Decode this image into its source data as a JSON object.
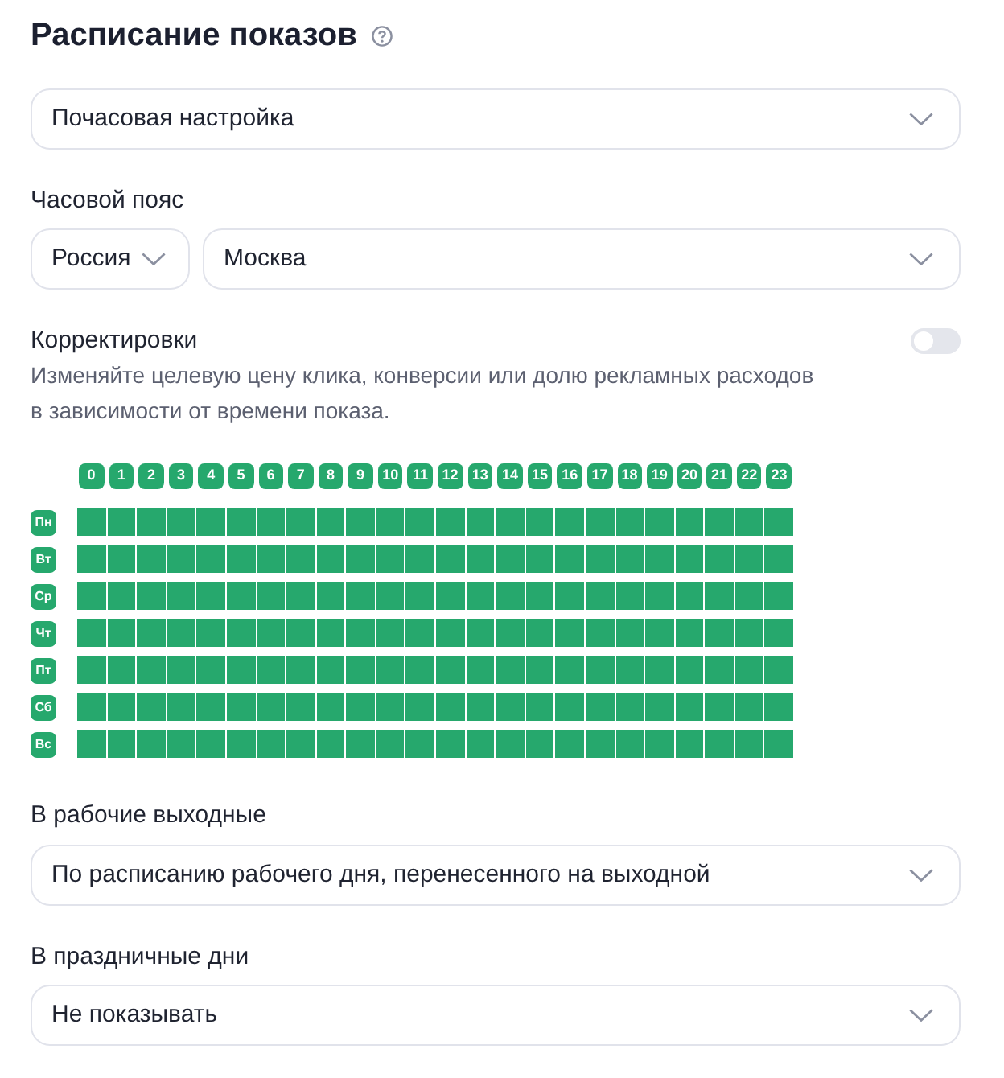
{
  "title": "Расписание показов",
  "mode": {
    "value": "Почасовая настройка"
  },
  "timezone": {
    "label": "Часовой пояс",
    "country": {
      "value": "Россия"
    },
    "city": {
      "value": "Москва"
    }
  },
  "adjustments": {
    "label": "Корректировки",
    "on": false,
    "description": "Изменяйте целевую цену клика, конверсии или долю рекламных расходов в зависимости от времени показа."
  },
  "schedule": {
    "hours": [
      "0",
      "1",
      "2",
      "3",
      "4",
      "5",
      "6",
      "7",
      "8",
      "9",
      "10",
      "11",
      "12",
      "13",
      "14",
      "15",
      "16",
      "17",
      "18",
      "19",
      "20",
      "21",
      "22",
      "23"
    ],
    "days": [
      {
        "label": "Пн",
        "cells": [
          true,
          true,
          true,
          true,
          true,
          true,
          true,
          true,
          true,
          true,
          true,
          true,
          true,
          true,
          true,
          true,
          true,
          true,
          true,
          true,
          true,
          true,
          true,
          true
        ]
      },
      {
        "label": "Вт",
        "cells": [
          true,
          true,
          true,
          true,
          true,
          true,
          true,
          true,
          true,
          true,
          true,
          true,
          true,
          true,
          true,
          true,
          true,
          true,
          true,
          true,
          true,
          true,
          true,
          true
        ]
      },
      {
        "label": "Ср",
        "cells": [
          true,
          true,
          true,
          true,
          true,
          true,
          true,
          true,
          true,
          true,
          true,
          true,
          true,
          true,
          true,
          true,
          true,
          true,
          true,
          true,
          true,
          true,
          true,
          true
        ]
      },
      {
        "label": "Чт",
        "cells": [
          true,
          true,
          true,
          true,
          true,
          true,
          true,
          true,
          true,
          true,
          true,
          true,
          true,
          true,
          true,
          true,
          true,
          true,
          true,
          true,
          true,
          true,
          true,
          true
        ]
      },
      {
        "label": "Пт",
        "cells": [
          true,
          true,
          true,
          true,
          true,
          true,
          true,
          true,
          true,
          true,
          true,
          true,
          true,
          true,
          true,
          true,
          true,
          true,
          true,
          true,
          true,
          true,
          true,
          true
        ]
      },
      {
        "label": "Сб",
        "cells": [
          true,
          true,
          true,
          true,
          true,
          true,
          true,
          true,
          true,
          true,
          true,
          true,
          true,
          true,
          true,
          true,
          true,
          true,
          true,
          true,
          true,
          true,
          true,
          true
        ]
      },
      {
        "label": "Вс",
        "cells": [
          true,
          true,
          true,
          true,
          true,
          true,
          true,
          true,
          true,
          true,
          true,
          true,
          true,
          true,
          true,
          true,
          true,
          true,
          true,
          true,
          true,
          true,
          true,
          true
        ]
      }
    ]
  },
  "working_weekends": {
    "label": "В рабочие выходные",
    "value": "По расписанию рабочего дня, перенесенного на выходной"
  },
  "holidays": {
    "label": "В праздничные дни",
    "value": "Не показывать"
  }
}
